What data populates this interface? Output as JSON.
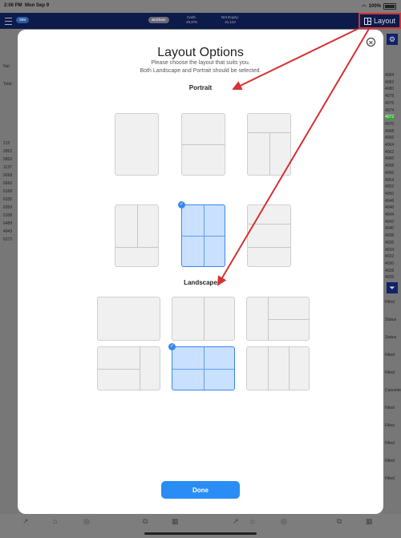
{
  "status_bar": {
    "time": "2:06 PM",
    "date": "Mon Sep 9",
    "battery": "100%"
  },
  "top_bar": {
    "badge": "SIM",
    "account_pill": "wickham",
    "cash_label": "Cash:",
    "cash_value": "29,975",
    "equity_label": "Net Equity:",
    "equity_value": "31,110",
    "layout_label": "Layout"
  },
  "background": {
    "left_labels": [
      "Nat",
      "Total",
      "212",
      "2852",
      "5852",
      "1137",
      "9268",
      "6660",
      "6168",
      "6335",
      "6359",
      "5108",
      "6489",
      "4943",
      "6272"
    ],
    "right_numbers": [
      "4084",
      "4082",
      "4080",
      "4078",
      "4076",
      "4074",
      "4072",
      "4070",
      "4068",
      "4066",
      "4064",
      "4062",
      "4060",
      "4058",
      "4056",
      "4054",
      "4052",
      "4050",
      "4048",
      "4046",
      "4044",
      "4042",
      "4040",
      "4038",
      "4036",
      "4034",
      "4032",
      "4030",
      "4028",
      "4026"
    ],
    "right_status": [
      "Filled",
      "Status",
      "Status",
      "Filled",
      "Filled",
      "Canceled",
      "Filled",
      "Filled",
      "Filled",
      "Filled",
      "Filled"
    ]
  },
  "modal": {
    "title": "Layout Options",
    "subtitle_line1": "Please choose the layout that suits you.",
    "subtitle_line2": "Both Landscape and Portrait should be selected.",
    "portrait_label": "Portrait",
    "landscape_label": "Landscape",
    "selected_portrait_index": 4,
    "selected_landscape_index": 4,
    "done_label": "Done"
  },
  "colors": {
    "accent": "#2a8df5",
    "selected_fill": "#c9e0ff",
    "nav_bg": "#0d1b4a",
    "highlight_red": "#d83030"
  }
}
